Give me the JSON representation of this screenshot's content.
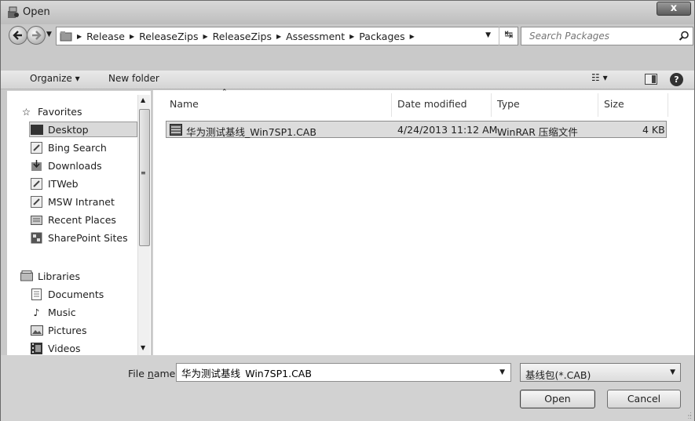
{
  "window": {
    "title": "Open",
    "close_label": "x"
  },
  "address": {
    "crumbs": [
      "Release",
      "ReleaseZips",
      "ReleaseZips",
      "Assessment",
      "Packages"
    ],
    "search_placeholder": "Search Packages"
  },
  "toolbar": {
    "organize_label": "Organize ▾",
    "new_folder_label": "New folder",
    "views_label": "☷ ▾"
  },
  "nav": {
    "favorites_label": "Favorites",
    "favorites": [
      "Desktop",
      "Bing Search",
      "Downloads",
      "ITWeb",
      "MSW Intranet",
      "Recent Places",
      "SharePoint Sites"
    ],
    "libraries_label": "Libraries",
    "libraries": [
      "Documents",
      "Music",
      "Pictures",
      "Videos"
    ]
  },
  "columns": {
    "name": "Name",
    "date": "Date modified",
    "type": "Type",
    "size": "Size"
  },
  "files": [
    {
      "name": "华为测试基线_Win7SP1.CAB",
      "date": "4/24/2013 11:12 AM",
      "type": "WinRAR 压缩文件",
      "size": "4 KB"
    }
  ],
  "bottom": {
    "file_name_label_pre": "File ",
    "file_name_label_u": "n",
    "file_name_label_post": "ame:",
    "file_name_value": "华为测试基线_Win7SP1.CAB",
    "filter_value": "基线包(*.CAB)",
    "open_label": "Open",
    "cancel_label": "Cancel"
  }
}
